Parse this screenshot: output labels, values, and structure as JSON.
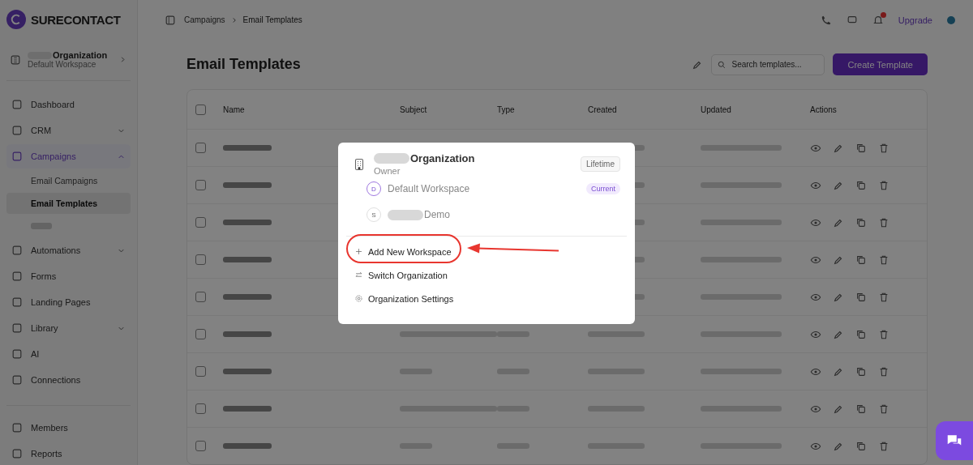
{
  "sidebar": {
    "logo": "SURECONTACT",
    "org_switcher": {
      "name": "Organization",
      "redacted": true,
      "workspace": "Default Workspace"
    },
    "items": [
      {
        "label": "Dashboard",
        "selected": false,
        "expandable": false
      },
      {
        "label": "CRM",
        "selected": false,
        "expandable": true
      },
      {
        "label": "Campaigns",
        "selected": true,
        "expandable": true,
        "expanded": true,
        "children": [
          {
            "label": "Email Campaigns",
            "selected": false
          },
          {
            "label": "Email Templates",
            "selected": true
          },
          {
            "kind": "blurred"
          }
        ]
      },
      {
        "label": "Automations",
        "selected": false,
        "expandable": true
      },
      {
        "label": "Forms",
        "selected": false,
        "expandable": false
      },
      {
        "label": "Landing Pages",
        "selected": false,
        "expandable": false
      },
      {
        "label": "Library",
        "selected": false,
        "expandable": true
      },
      {
        "label": "AI",
        "selected": false,
        "expandable": false
      },
      {
        "label": "Connections",
        "selected": false,
        "expandable": false
      }
    ],
    "bottom_items": [
      {
        "label": "Members"
      },
      {
        "label": "Reports"
      }
    ]
  },
  "header": {
    "breadcrumb": [
      "Campaigns",
      "Email Templates"
    ],
    "upgrade": "Upgrade"
  },
  "page": {
    "title": "Email Templates",
    "search": {
      "placeholder": "Search templates..."
    },
    "create_button": "Create Template"
  },
  "table": {
    "columns": [
      "Name",
      "Subject",
      "Type",
      "Created",
      "Updated",
      "Actions"
    ],
    "all_checked": false,
    "rows": [
      {
        "kind": "blurred",
        "checked": false
      },
      {
        "kind": "blurred",
        "checked": false
      },
      {
        "kind": "blurred",
        "checked": false
      },
      {
        "kind": "blurred",
        "checked": false
      },
      {
        "kind": "blurred",
        "checked": false
      },
      {
        "kind": "blurred",
        "checked": false
      },
      {
        "kind": "blurred",
        "checked": false
      },
      {
        "kind": "blurred",
        "checked": false
      },
      {
        "kind": "blurred",
        "checked": false
      }
    ]
  },
  "popup": {
    "organization": {
      "name": "Organization",
      "redacted": true,
      "role": "Owner",
      "plan": "Lifetime"
    },
    "workspaces": [
      {
        "initial": "D",
        "name": "Default Workspace",
        "redacted": false,
        "current": true,
        "badge": "Current"
      },
      {
        "initial": "S",
        "name": "Demo",
        "redacted": true,
        "current": false
      }
    ],
    "actions": [
      {
        "kind": "add",
        "label": "Add New Workspace",
        "highlighted": true
      },
      {
        "kind": "switch",
        "label": "Switch Organization",
        "highlighted": false
      },
      {
        "kind": "settings",
        "label": "Organization Settings",
        "highlighted": false
      }
    ]
  }
}
